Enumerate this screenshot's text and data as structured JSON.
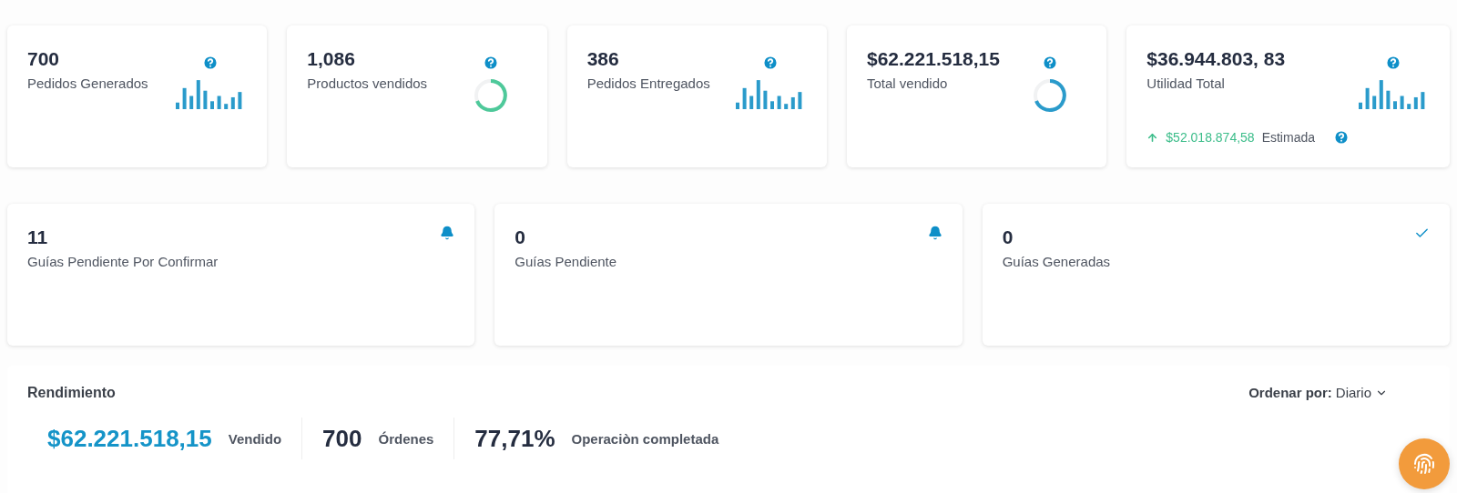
{
  "stat_cards": [
    {
      "value": "700",
      "label": "Pedidos Generados",
      "kind": "bars"
    },
    {
      "value": "1,086",
      "label": "Productos vendidos",
      "kind": "donut",
      "color": "#4ec99a"
    },
    {
      "value": "386",
      "label": "Pedidos Entregados",
      "kind": "bars"
    },
    {
      "value": "$62.221.518,15",
      "label": "Total vendido",
      "kind": "donut",
      "color": "#2a9bcb"
    },
    {
      "value": "$36.944.803, 83",
      "label": "Utilidad Total",
      "kind": "bars",
      "estimate": {
        "amount": "$52.018.874,58",
        "label": "Estimada"
      }
    }
  ],
  "guide_cards": [
    {
      "value": "11",
      "label": "Guías Pendiente Por Confirmar",
      "kind": "alert"
    },
    {
      "value": "0",
      "label": "Guías Pendiente",
      "kind": "alert"
    },
    {
      "value": "0",
      "label": "Guías Generadas",
      "kind": "done"
    }
  ],
  "performance": {
    "title": "Rendimiento",
    "sort_label": "Ordenar por:",
    "sort_value": "Diario",
    "metrics": [
      {
        "value": "$62.221.518,15",
        "label": "Vendido",
        "kind": "accent"
      },
      {
        "value": "700",
        "label": "Órdenes",
        "kind": "plain"
      },
      {
        "value": "77,71%",
        "label": "Operaciòn completada",
        "kind": "plain"
      }
    ]
  }
}
